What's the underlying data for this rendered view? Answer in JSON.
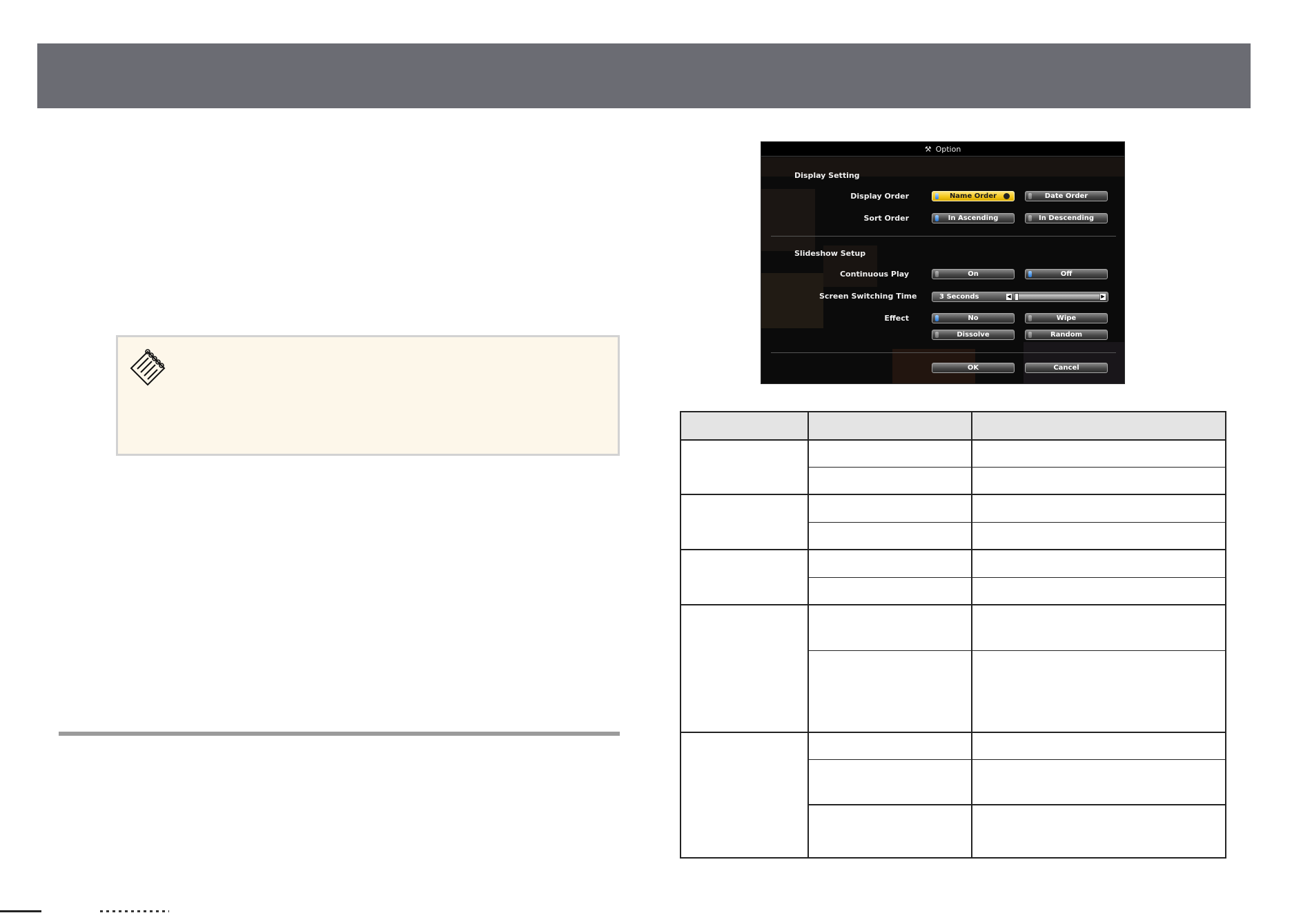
{
  "dialog": {
    "title": "Option",
    "display_setting": {
      "heading": "Display Setting",
      "display_order_label": "Display Order",
      "display_order_options": [
        "Name Order",
        "Date Order"
      ],
      "display_order_selected": "Name Order",
      "sort_order_label": "Sort Order",
      "sort_order_options": [
        "In Ascending",
        "In Descending"
      ],
      "sort_order_selected": "In Ascending"
    },
    "slideshow_setup": {
      "heading": "Slideshow Setup",
      "continuous_play_label": "Continuous Play",
      "continuous_play_options": [
        "On",
        "Off"
      ],
      "continuous_play_selected": "Off",
      "screen_switching_label": "Screen Switching Time",
      "screen_switching_value": "3 Seconds",
      "screen_switching_level": 0.0,
      "effect_label": "Effect",
      "effect_options": [
        "No",
        "Wipe",
        "Dissolve",
        "Random"
      ],
      "effect_selected": "No"
    },
    "ok_label": "OK",
    "cancel_label": "Cancel"
  },
  "colors": {
    "header_bar": "#6b6c73",
    "note_background": "#fdf7ea",
    "selected_button": "#f3c416",
    "toggle_on": "#1f73d6"
  },
  "icons": {
    "note": "note-pad-icon",
    "dialog_title": "tools-icon"
  }
}
